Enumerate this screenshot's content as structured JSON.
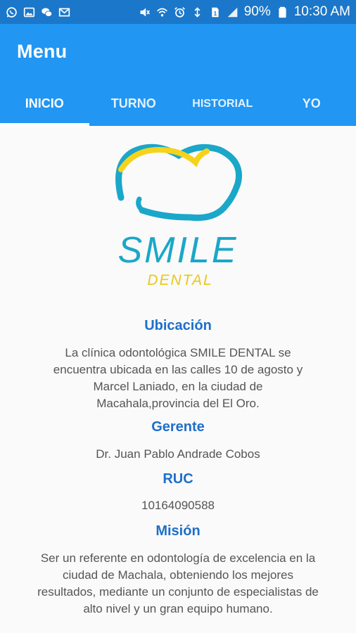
{
  "status_bar": {
    "battery": "90%",
    "time": "10:30 AM",
    "icons_left": [
      "whatsapp-icon",
      "gallery-icon",
      "wechat-icon",
      "email-icon"
    ],
    "icons_right": [
      "mute-icon",
      "wifi-calling-icon",
      "alarm-icon",
      "data-icon",
      "sim-icon",
      "signal-icon",
      "battery-icon"
    ]
  },
  "app_bar": {
    "title": "Menu",
    "color": "#2196f3"
  },
  "tabs": [
    {
      "label": "INICIO",
      "active": true
    },
    {
      "label": "TURNO",
      "active": false
    },
    {
      "label": "HISTORIAL",
      "active": false
    },
    {
      "label": "YO",
      "active": false
    }
  ],
  "logo": {
    "brand": "SMILE",
    "sub": "DENTAL",
    "brand_color": "#1aa7c9",
    "accent_color": "#f5d31c"
  },
  "info": {
    "ubicacion_title": "Ubicación",
    "ubicacion_text": "La clínica odontológica SMILE DENTAL se encuentra ubicada en las calles 10 de agosto y Marcel Laniado, en la ciudad de Macahala,provincia del El Oro.",
    "gerente_title": "Gerente",
    "gerente_text": "Dr. Juan Pablo Andrade Cobos",
    "ruc_title": "RUC",
    "ruc_text": "10164090588",
    "mision_title": "Misión",
    "mision_text": "Ser un referente en odontología de excelencia en la ciudad de Machala, obteniendo los mejores resultados, mediante un conjunto de especialistas de alto nivel y un gran equipo humano."
  }
}
